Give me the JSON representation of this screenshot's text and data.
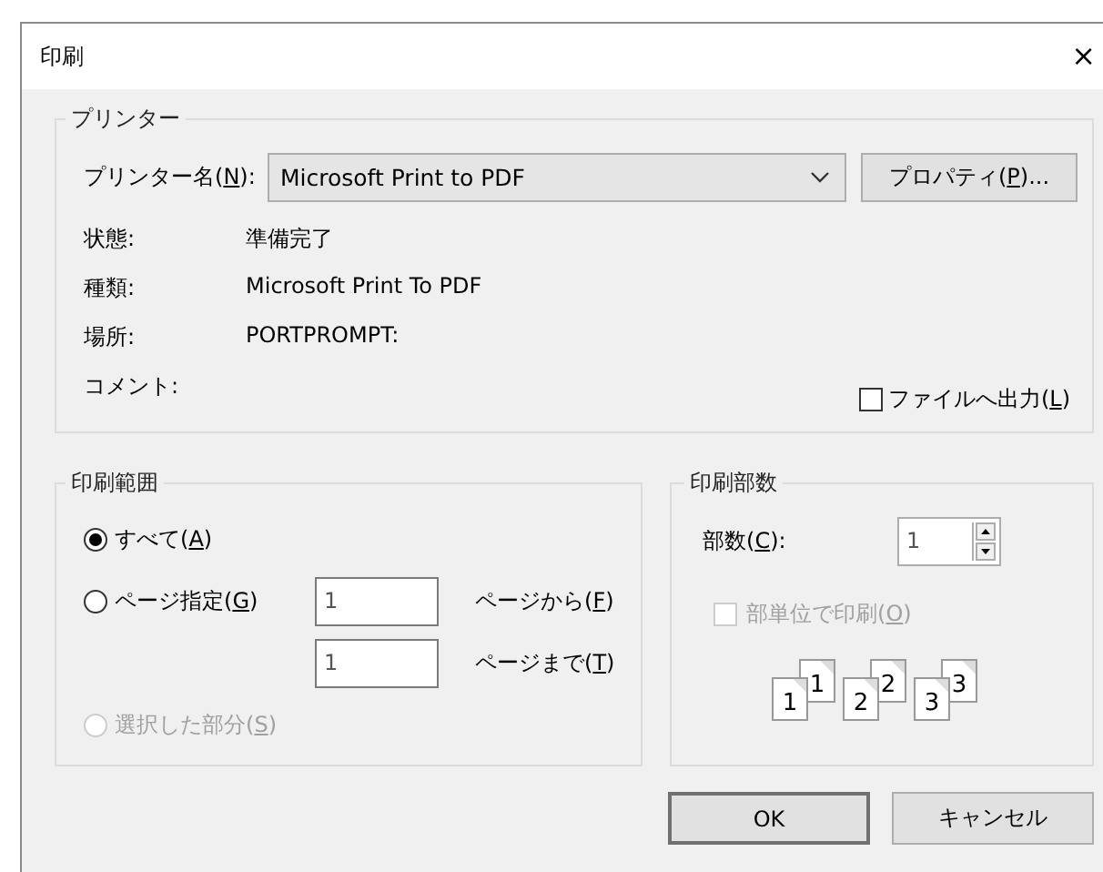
{
  "window": {
    "title": "印刷",
    "close": "×"
  },
  "printer": {
    "legend": "プリンター",
    "name_label": "プリンター名(",
    "name_key": "N",
    "name_label_end": "):",
    "name_value": "Microsoft Print to PDF",
    "properties_button": "プロパティ(",
    "properties_key": "P",
    "properties_button_end": ")...",
    "info": [
      {
        "label": "状態:",
        "value": "準備完了"
      },
      {
        "label": "種類:",
        "value": "Microsoft Print To PDF"
      },
      {
        "label": "場所:",
        "value": "PORTPROMPT:"
      },
      {
        "label": "コメント:"
      }
    ],
    "print_to_file": {
      "label": "ファイルへ出力(",
      "access_key": "L",
      "label_end": ")",
      "checked": false,
      "disabled": false
    }
  },
  "range": {
    "legend": "印刷範囲",
    "options": [
      {
        "kind": "all",
        "label": "すべて(",
        "access_key": "A",
        "label_end": ")",
        "selected": true,
        "disabled": false
      },
      {
        "kind": "pages",
        "label": "ページ指定(",
        "access_key": "G",
        "label_end": ")",
        "selected": false,
        "disabled": false,
        "from_value": "1",
        "from_label": "ページから(",
        "from_key": "F",
        "from_label_end": ")",
        "to_value": "1",
        "to_label": "ページまで(",
        "to_key": "T",
        "to_label_end": ")"
      },
      {
        "kind": "selection",
        "label": "選択した部分(",
        "access_key": "S",
        "label_end": ")",
        "selected": false,
        "disabled": true
      }
    ]
  },
  "copies": {
    "legend": "印刷部数",
    "count_label": "部数(",
    "count_key": "C",
    "count_label_end": "):",
    "count_value": "1",
    "collate": {
      "label": "部単位で印刷(",
      "access_key": "O",
      "label_end": ")",
      "checked": false,
      "disabled": true
    },
    "stacks": [
      {
        "front": "1",
        "back": "1"
      },
      {
        "front": "2",
        "back": "2"
      },
      {
        "front": "3",
        "back": "3"
      }
    ]
  },
  "buttons": [
    {
      "label": "OK",
      "default": true
    },
    {
      "label": "キャンセル",
      "default": false
    }
  ]
}
